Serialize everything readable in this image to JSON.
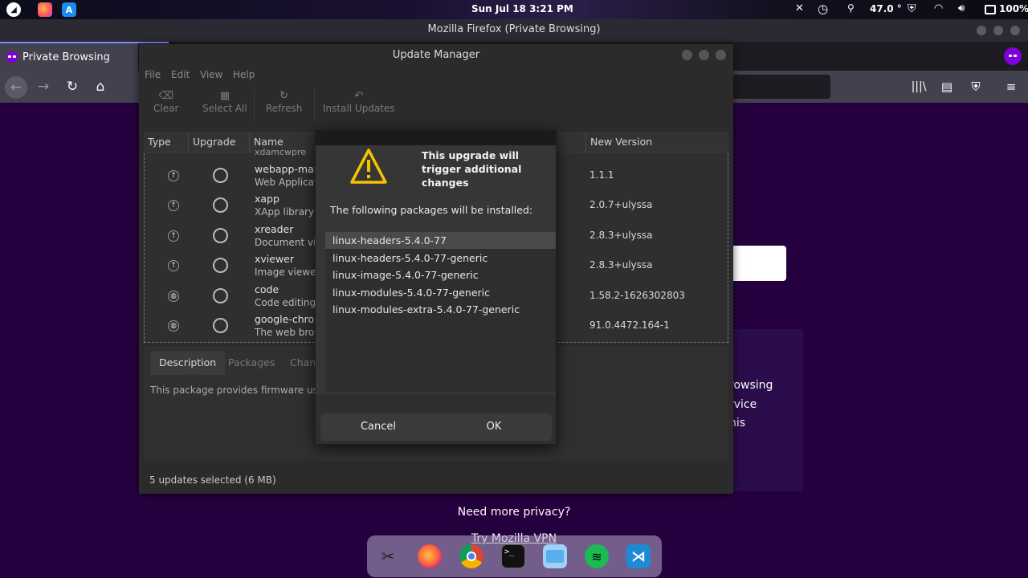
{
  "top_panel": {
    "clock": "Sun Jul 18   3:21 PM",
    "temperature": "47.0 °",
    "battery": "100%",
    "apps": [
      "launcher-icon",
      "firefox-icon",
      "app-store-icon"
    ]
  },
  "firefox": {
    "window_title": "Mozilla Firefox (Private Browsing)",
    "tab_title": "Private Browsing",
    "info_lines": [
      "rowsing",
      "rvice",
      "nis"
    ],
    "need_privacy": "Need more privacy?",
    "try_vpn": "Try Mozilla VPN"
  },
  "update_manager": {
    "title": "Update Manager",
    "menu": [
      "File",
      "Edit",
      "View",
      "Help"
    ],
    "toolbar": {
      "clear": "Clear",
      "select_all": "Select All",
      "refresh": "Refresh",
      "install": "Install Updates"
    },
    "columns": [
      "Type",
      "Upgrade",
      "Name",
      "New Version"
    ],
    "partial_row_name": "xdamcwpre",
    "rows": [
      {
        "type_icon": "arrow-up-icon",
        "name": "webapp-mana",
        "desc": "Web Applicati",
        "version": "1.1.1"
      },
      {
        "type_icon": "arrow-up-icon",
        "name": "xapp",
        "desc": "XApp library",
        "version": "2.0.7+ulyssa"
      },
      {
        "type_icon": "arrow-up-icon",
        "name": "xreader",
        "desc": "Document view",
        "version": "2.8.3+ulyssa"
      },
      {
        "type_icon": "arrow-up-icon",
        "name": "xviewer",
        "desc": "Image viewer",
        "version": "2.8.3+ulyssa"
      },
      {
        "type_icon": "globe-icon",
        "name": "code",
        "desc": "Code editing. I",
        "version": "1.58.2-1626302803"
      },
      {
        "type_icon": "globe-icon",
        "name": "google-chrom",
        "desc": "The web brow",
        "version": "91.0.4472.164-1"
      }
    ],
    "tabs": [
      "Description",
      "Packages",
      "Chang"
    ],
    "description": "This package provides firmware used l",
    "status": "5 updates selected (6 MB)"
  },
  "dialog": {
    "title": "This upgrade will trigger additional changes",
    "subtitle": "The following packages will be installed:",
    "packages": [
      "linux-headers-5.4.0-77",
      "linux-headers-5.4.0-77-generic",
      "linux-image-5.4.0-77-generic",
      "linux-modules-5.4.0-77-generic",
      "linux-modules-extra-5.4.0-77-generic"
    ],
    "cancel": "Cancel",
    "ok": "OK"
  },
  "dock": {
    "apps": [
      "scissors-icon",
      "firefox-icon",
      "chrome-icon",
      "terminal-icon",
      "files-icon",
      "spotify-icon",
      "vscode-icon"
    ],
    "terminal_prompt": ">_"
  },
  "colors": {
    "private_purple": "#8000d7",
    "firefox_content_bg": "#25003e",
    "dialog_bg": "#363636"
  }
}
